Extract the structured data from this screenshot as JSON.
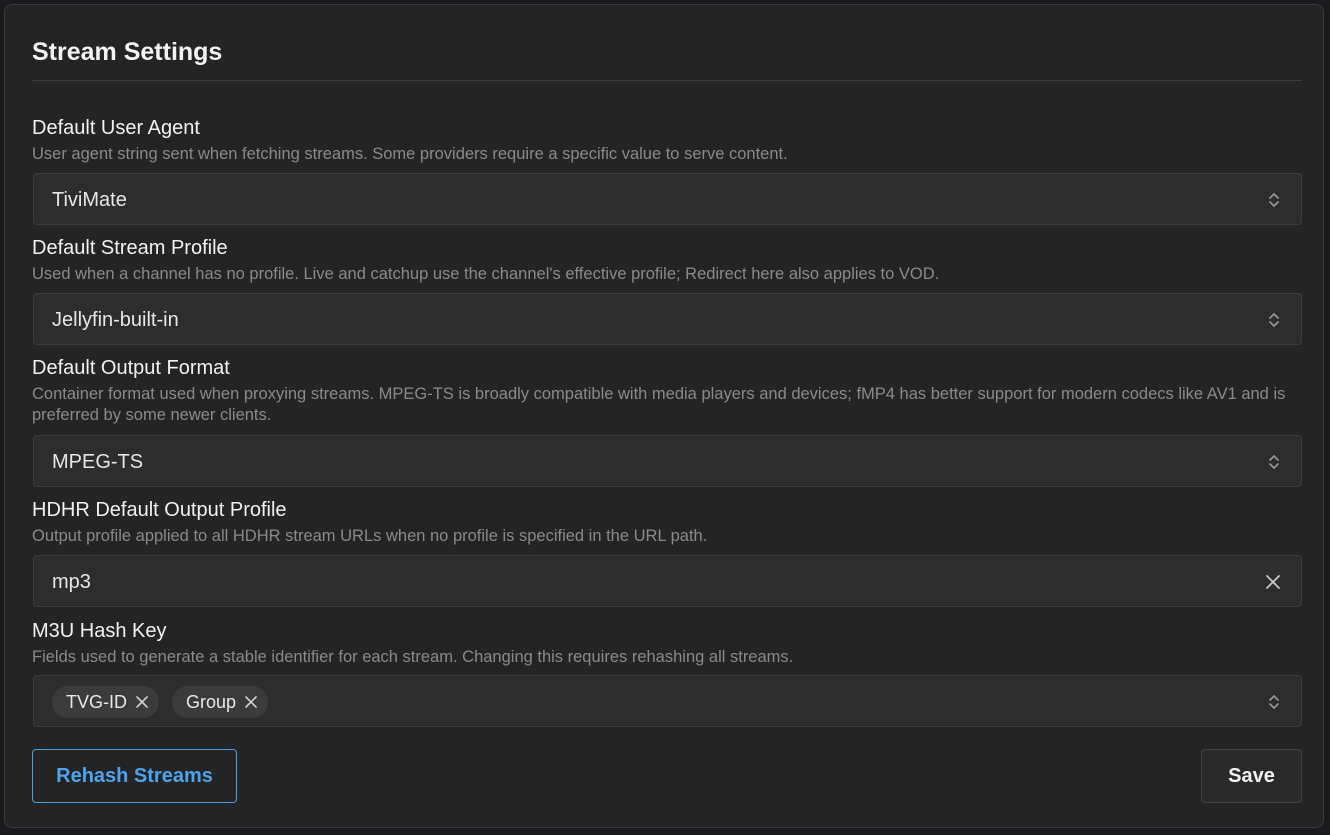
{
  "panel": {
    "title": "Stream Settings"
  },
  "fields": {
    "user_agent": {
      "label": "Default User Agent",
      "description": "User agent string sent when fetching streams. Some providers require a specific value to serve content.",
      "value": "TiviMate",
      "icon": "chevron-up-down-icon"
    },
    "stream_profile": {
      "label": "Default Stream Profile",
      "description": "Used when a channel has no profile. Live and catchup use the channel's effective profile; Redirect here also applies to VOD.",
      "value": "Jellyfin-built-in",
      "icon": "chevron-up-down-icon"
    },
    "output_format": {
      "label": "Default Output Format",
      "description": "Container format used when proxying streams. MPEG-TS is broadly compatible with media players and devices; fMP4 has better support for modern codecs like AV1 and is preferred by some newer clients.",
      "value": "MPEG-TS",
      "icon": "chevron-up-down-icon"
    },
    "hdhr_profile": {
      "label": "HDHR Default Output Profile",
      "description": "Output profile applied to all HDHR stream URLs when no profile is specified in the URL path.",
      "value": "mp3",
      "icon": "close-icon"
    },
    "hash_key": {
      "label": "M3U Hash Key",
      "description": "Fields used to generate a stable identifier for each stream. Changing this requires rehashing all streams.",
      "tags": [
        "TVG-ID",
        "Group"
      ],
      "icon": "chevron-up-down-icon"
    }
  },
  "actions": {
    "rehash_label": "Rehash Streams",
    "save_label": "Save"
  },
  "colors": {
    "accent": "#4da3ee",
    "panel_bg": "#242424",
    "input_bg": "#2d2d2d",
    "muted_text": "#8a8a8a"
  }
}
